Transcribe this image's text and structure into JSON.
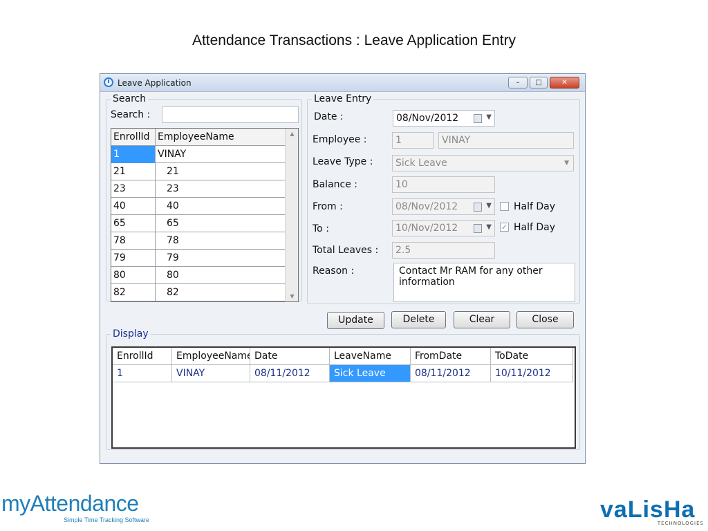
{
  "slide": {
    "title": "Attendance Transactions : Leave Application Entry"
  },
  "window": {
    "title": "Leave Application",
    "controls": {
      "minimize": "–",
      "maximize": "□",
      "close": "✕"
    }
  },
  "search": {
    "group_label": "Search",
    "field_label": "Search :",
    "value": "",
    "columns": [
      "EnrollId",
      "EmployeeName"
    ],
    "rows": [
      {
        "id": "1",
        "name": "VINAY"
      },
      {
        "id": "21",
        "name": "21"
      },
      {
        "id": "23",
        "name": "23"
      },
      {
        "id": "40",
        "name": "40"
      },
      {
        "id": "65",
        "name": "65"
      },
      {
        "id": "78",
        "name": "78"
      },
      {
        "id": "79",
        "name": "79"
      },
      {
        "id": "80",
        "name": "80"
      },
      {
        "id": "82",
        "name": "82"
      }
    ]
  },
  "leave_entry": {
    "group_label": "Leave Entry",
    "date_label": "Date :",
    "date_value": "08/Nov/2012",
    "employee_label": "Employee :",
    "employee_id": "1",
    "employee_name": "VINAY",
    "leave_type_label": "Leave Type :",
    "leave_type_value": "Sick Leave",
    "balance_label": "Balance :",
    "balance_value": "10",
    "from_label": "From :",
    "from_value": "08/Nov/2012",
    "from_half_day_label": "Half Day",
    "from_half_day_checked": false,
    "to_label": "To :",
    "to_value": "10/Nov/2012",
    "to_half_day_label": "Half Day",
    "to_half_day_checked": true,
    "total_label": "Total Leaves :",
    "total_value": "2.5",
    "reason_label": "Reason :",
    "reason_value": "Contact Mr RAM for any other information"
  },
  "actions": {
    "update": "Update",
    "delete": "Delete",
    "clear": "Clear",
    "close": "Close"
  },
  "display": {
    "group_label": "Display",
    "columns": [
      "EnrollId",
      "EmployeeName",
      "Date",
      "LeaveName",
      "FromDate",
      "ToDate"
    ],
    "rows": [
      {
        "enroll": "1",
        "name": "VINAY",
        "date": "08/11/2012",
        "leave": "Sick Leave",
        "from": "08/11/2012",
        "to": "10/11/2012"
      }
    ]
  },
  "logos": {
    "left_word": "myAttendance",
    "left_tagline": "Simple Time Tracking Software",
    "right_word": "vaLisHa",
    "right_sub": "TECHNOLOGIES"
  },
  "colors": {
    "selection": "#3399ff",
    "brand_blue": "#1f7fb8",
    "display_text": "#1b2f8c"
  }
}
